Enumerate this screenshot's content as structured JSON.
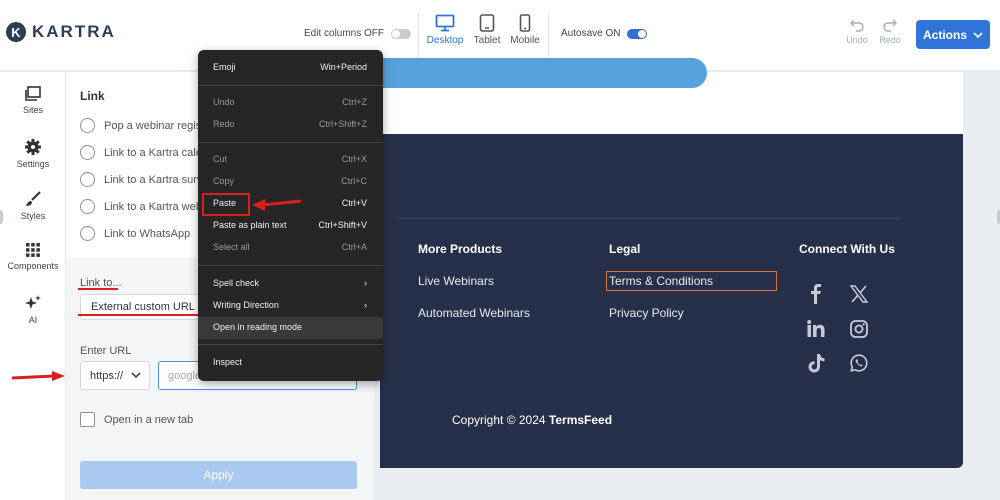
{
  "header": {
    "logo_text": "KARTRA",
    "edit_columns_label": "Edit columns OFF",
    "devices": [
      {
        "label": "Desktop",
        "active": true
      },
      {
        "label": "Tablet",
        "active": false
      },
      {
        "label": "Mobile",
        "active": false
      }
    ],
    "autosave_label": "Autosave ON",
    "undo_label": "Undo",
    "redo_label": "Redo",
    "actions_label": "Actions"
  },
  "rail": {
    "items": [
      {
        "label": "Sites",
        "icon": "sites-icon"
      },
      {
        "label": "Settings",
        "icon": "gear-icon"
      },
      {
        "label": "Styles",
        "icon": "brush-icon"
      },
      {
        "label": "Components",
        "icon": "grid-icon"
      },
      {
        "label": "AI",
        "icon": "sparkle-icon"
      }
    ]
  },
  "panel": {
    "title": "Link",
    "options": [
      "Pop a webinar regis",
      "Link to a Kartra cale",
      "Link to a Kartra surv",
      "Link to a Kartra web",
      "Link to WhatsApp"
    ],
    "link_to_label": "Link to...",
    "link_to_value": "External custom URL",
    "enter_url_label": "Enter URL",
    "protocol_value": "https://",
    "url_value": "google",
    "new_tab_label": "Open in a new tab",
    "apply_label": "Apply"
  },
  "context_menu": {
    "items": [
      {
        "label": "Emoji",
        "shortcut": "Win+Period",
        "disabled": false
      },
      {
        "label": "Undo",
        "shortcut": "Ctrl+Z",
        "disabled": true
      },
      {
        "label": "Redo",
        "shortcut": "Ctrl+Shift+Z",
        "disabled": true
      },
      {
        "label": "Cut",
        "shortcut": "Ctrl+X",
        "disabled": true
      },
      {
        "label": "Copy",
        "shortcut": "Ctrl+C",
        "disabled": true
      },
      {
        "label": "Paste",
        "shortcut": "Ctrl+V",
        "disabled": false
      },
      {
        "label": "Paste as plain text",
        "shortcut": "Ctrl+Shift+V",
        "disabled": false
      },
      {
        "label": "Select all",
        "shortcut": "Ctrl+A",
        "disabled": true
      },
      {
        "label": "Spell check",
        "shortcut": "›",
        "disabled": false
      },
      {
        "label": "Writing Direction",
        "shortcut": "›",
        "disabled": false
      },
      {
        "label": "Open in reading mode",
        "shortcut": "",
        "disabled": false
      },
      {
        "label": "Inspect",
        "shortcut": "",
        "disabled": false
      }
    ]
  },
  "footer": {
    "columns": [
      {
        "heading": "More Products",
        "links": [
          "Live Webinars",
          "Automated Webinars"
        ]
      },
      {
        "heading": "Legal",
        "links": [
          "Terms & Conditions",
          "Privacy Policy"
        ]
      },
      {
        "heading": "Connect With Us",
        "links": []
      }
    ],
    "social_icons": [
      "facebook-icon",
      "x-icon",
      "linkedin-icon",
      "instagram-icon",
      "tiktok-icon",
      "whatsapp-icon"
    ],
    "copyright_prefix": "Copyright © 2024",
    "copyright_brand": "TermsFeed"
  },
  "colors": {
    "accent": "#2f74d8",
    "footer_bg": "#27304a",
    "annotation_red": "#d8211e",
    "highlight_box": "#d9763a"
  }
}
